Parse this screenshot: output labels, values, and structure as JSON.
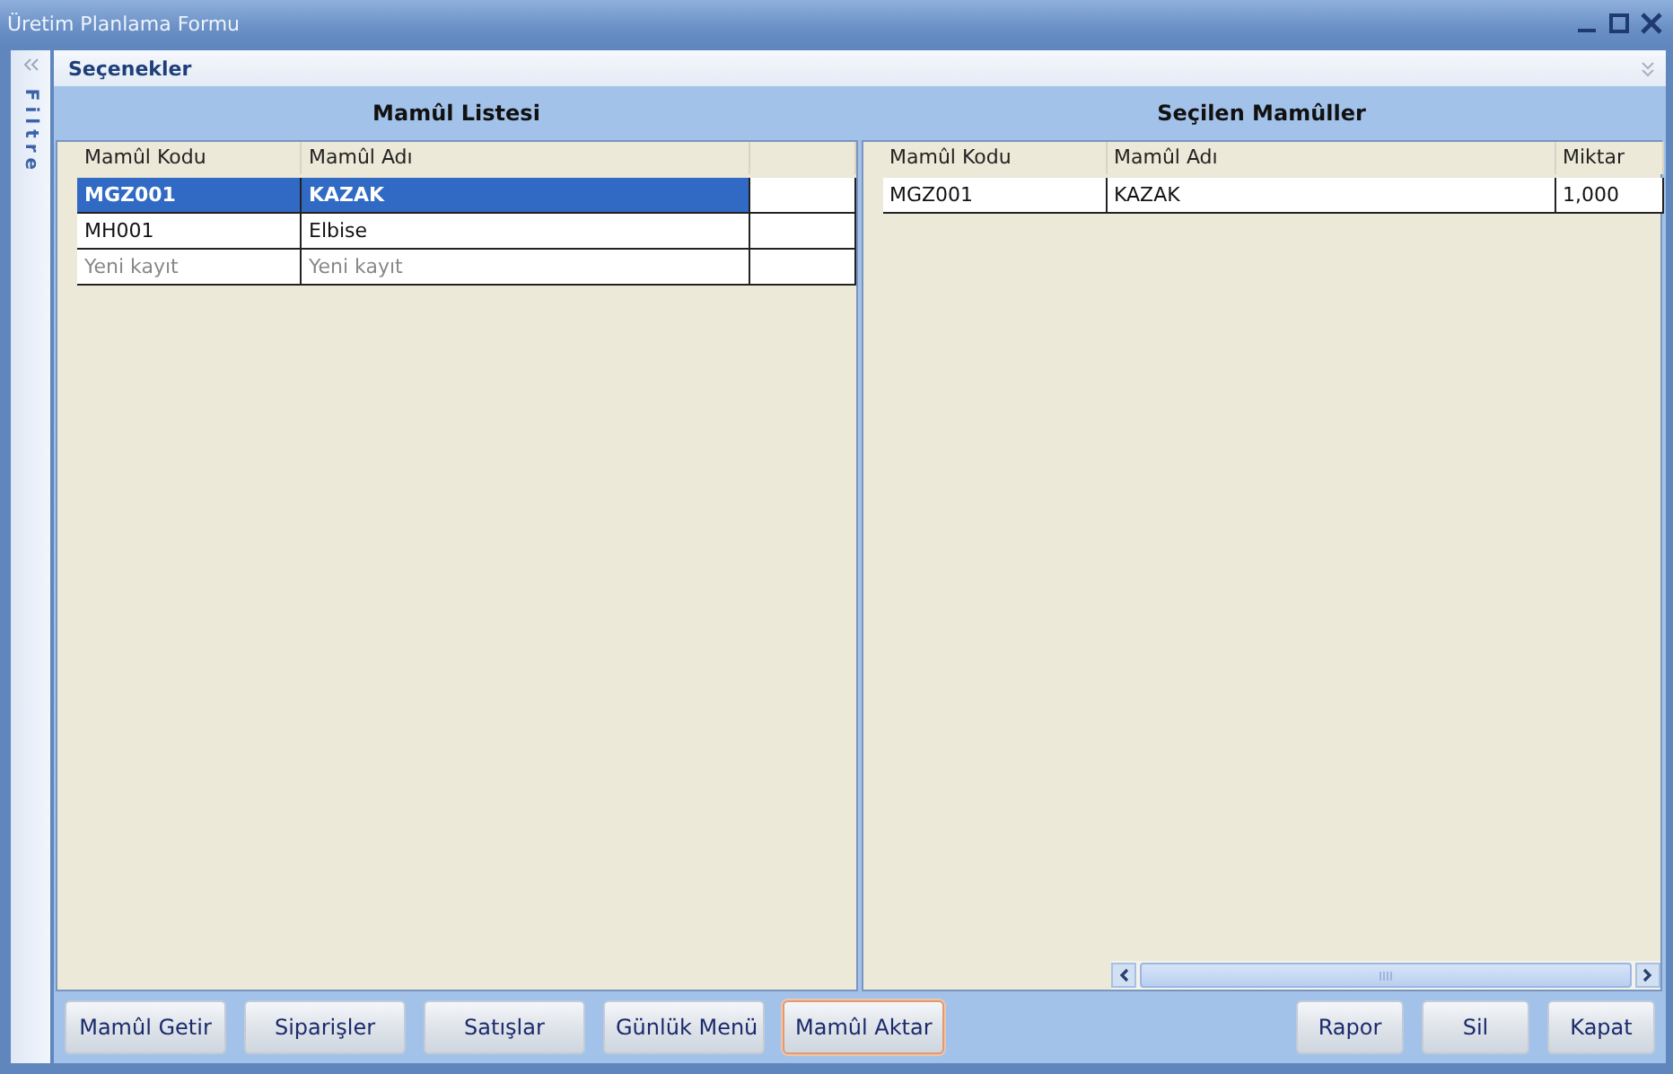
{
  "window": {
    "title": "Üretim Planlama Formu"
  },
  "filter_panel": {
    "label": "Filtre"
  },
  "options_bar": {
    "title": "Seçenekler"
  },
  "product_list": {
    "title": "Mamûl Listesi",
    "columns": [
      "Mamûl Kodu",
      "Mamûl Adı"
    ],
    "rows": [
      {
        "kind": "record",
        "selected": true,
        "cells": [
          "MGZ001",
          "KAZAK"
        ]
      },
      {
        "kind": "record",
        "selected": false,
        "cells": [
          "MH001",
          "Elbise"
        ]
      },
      {
        "kind": "new",
        "selected": false,
        "cells": [
          "Yeni kayıt",
          "Yeni kayıt"
        ]
      }
    ]
  },
  "selected_products": {
    "title": "Seçilen Mamûller",
    "columns": [
      "Mamûl Kodu",
      "Mamûl Adı",
      "Miktar"
    ],
    "rows": [
      {
        "cells": [
          "MGZ001",
          "KAZAK",
          "1,000"
        ]
      }
    ]
  },
  "left_buttons": [
    {
      "label": "Mamûl Getir",
      "focused": false
    },
    {
      "label": "Siparişler",
      "focused": false
    },
    {
      "label": "Satışlar",
      "focused": false
    },
    {
      "label": "Günlük Menü",
      "focused": false
    },
    {
      "label": "Mamûl Aktar",
      "focused": true
    }
  ],
  "right_buttons": [
    {
      "label": "Rapor",
      "focused": false
    },
    {
      "label": "Sil",
      "focused": false
    },
    {
      "label": "Kapat",
      "focused": false
    }
  ]
}
